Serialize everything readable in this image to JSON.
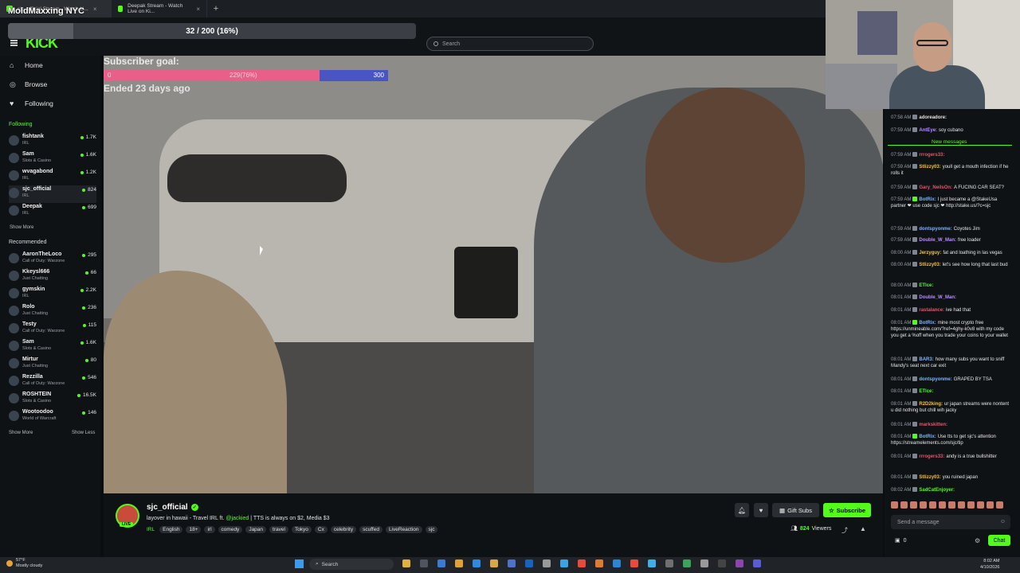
{
  "overlay": {
    "title": "MoldMaxxing NYC",
    "progress_text": "32 / 200 (16%)",
    "progress_fraction": 0.16
  },
  "browser": {
    "tabs": [
      {
        "label": "sjc_official Stream - Watch Li...",
        "active": true
      },
      {
        "label": "Deepak Stream - Watch Live on Ki...",
        "active": false
      }
    ],
    "new_tab": "+"
  },
  "header": {
    "logo": "KICK",
    "search_placeholder": "Search"
  },
  "sidebar": {
    "nav": [
      {
        "label": "Home",
        "icon": "home-icon",
        "glyph": "⌂"
      },
      {
        "label": "Browse",
        "icon": "compass-icon",
        "glyph": "◎"
      },
      {
        "label": "Following",
        "icon": "heart-icon",
        "glyph": "♥"
      }
    ],
    "following_label": "Following",
    "following": [
      {
        "name": "fishtank",
        "category": "IRL",
        "count": "1.7K"
      },
      {
        "name": "Sam",
        "category": "Slots & Casino",
        "count": "1.6K"
      },
      {
        "name": "wvagabond",
        "category": "IRL",
        "count": "1.2K"
      },
      {
        "name": "sjc_official",
        "category": "IRL",
        "count": "824"
      },
      {
        "name": "Deepak",
        "category": "IRL",
        "count": "699"
      }
    ],
    "show_more": "Show More",
    "recommended_label": "Recommended",
    "recommended": [
      {
        "name": "AaronTheLoco",
        "category": "Call of Duty: Warzone",
        "count": "295"
      },
      {
        "name": "Kkeysl666",
        "category": "Just Chatting",
        "count": "66"
      },
      {
        "name": "gymskin",
        "category": "IRL",
        "count": "2.2K"
      },
      {
        "name": "Rolo",
        "category": "Just Chatting",
        "count": "236"
      },
      {
        "name": "Testy",
        "category": "Call of Duty: Warzone",
        "count": "115"
      },
      {
        "name": "Sam",
        "category": "Slots & Casino",
        "count": "1.6K"
      },
      {
        "name": "Mirtur",
        "category": "Just Chatting",
        "count": "80"
      },
      {
        "name": "Rezzilla",
        "category": "Call of Duty: Warzone",
        "count": "546"
      },
      {
        "name": "ROSHTEIN",
        "category": "Slots & Casino",
        "count": "16.5K"
      },
      {
        "name": "Wootoodoo",
        "category": "World of Warcraft",
        "count": "146"
      }
    ],
    "show_more_2": "Show More",
    "show_less": "Show Less"
  },
  "goal": {
    "label": "Subscriber goal:",
    "start": "0",
    "current": "229(76%)",
    "end": "300",
    "fraction": 0.76,
    "ended": "Ended 23 days ago"
  },
  "stream": {
    "channel": "sjc_official",
    "live_badge": "LIVE",
    "title_pre": "layover in hawaii - Travel IRL ft. ",
    "title_mention": "@jackied",
    "title_post": " | TTS is always on $2, Media $3",
    "category": "IRL",
    "tags": [
      "English",
      "18+",
      "irl",
      "comedy",
      "Japan",
      "travel",
      "Tokyo",
      "Cx",
      "celebrity",
      "scuffed",
      "LiveReaction",
      "sjc"
    ],
    "gift_subs": "Gift Subs",
    "subscribe": "Subscribe",
    "viewers_count": "824",
    "viewers_label": "Viewers"
  },
  "chat": {
    "messages_top": [
      {
        "time": "07:58 AM",
        "user": "adoreadore:",
        "color": "#e0e0e0",
        "text": ""
      },
      {
        "time": "07:59 AM",
        "user": "AntEye:",
        "color": "#b98cff",
        "text": "soy cubano"
      }
    ],
    "new_messages": "New messages",
    "messages": [
      {
        "time": "07:59 AM",
        "user": "rrrogers33:",
        "color": "#e2566c",
        "text": ""
      },
      {
        "time": "07:59 AM",
        "user": "Stlizzy03:",
        "color": "#f3c23e",
        "text": "youll get a mouth infection if he rolls it"
      },
      {
        "time": "07:59 AM",
        "user": "Gary_NeilsOn:",
        "color": "#e2566c",
        "text": "A FUCING CAR SEAT?"
      },
      {
        "time": "07:59 AM",
        "user": "BotRix:",
        "color": "#7fb2ff",
        "text": "I just became a @StakeUsa partner ❤ use code sjc ❤ http://stake.us/?c=sjc"
      },
      {
        "time": "07:59 AM",
        "user": "dontspyonme:",
        "color": "#7fb2ff",
        "text": "Coyotes Jim"
      },
      {
        "time": "07:59 AM",
        "user": "Double_W_Man:",
        "color": "#b98cff",
        "text": "free loader"
      },
      {
        "time": "08:00 AM",
        "user": "Jerzyguy:",
        "color": "#f3c23e",
        "text": "fat and loathing in las vegas"
      },
      {
        "time": "08:00 AM",
        "user": "Stlizzy03:",
        "color": "#f3c23e",
        "text": "let's see how long that last bud"
      },
      {
        "time": "08:00 AM",
        "user": "ETlce:",
        "color": "#53fc18",
        "text": ""
      },
      {
        "time": "08:01 AM",
        "user": "Double_W_Man:",
        "color": "#b98cff",
        "text": ""
      },
      {
        "time": "08:01 AM",
        "user": "rastalance:",
        "color": "#e2566c",
        "text": "ive had that"
      },
      {
        "time": "08:01 AM",
        "user": "BotRix:",
        "color": "#7fb2ff",
        "text": "mine most crypto free https://unmineable.com/?ref=4ghy-k0v8 with my code you get a %off when you trade your coins to your wallet"
      },
      {
        "time": "08:01 AM",
        "user": "BAR3:",
        "color": "#7fb2ff",
        "text": "how many subs you want to sniff Mandy's seat next car exit"
      },
      {
        "time": "08:01 AM",
        "user": "dontspyonme:",
        "color": "#7fb2ff",
        "text": "GRAPED BY TSA"
      },
      {
        "time": "08:01 AM",
        "user": "ETlce:",
        "color": "#53fc18",
        "text": ""
      },
      {
        "time": "08:01 AM",
        "user": "R2D2king:",
        "color": "#f3c23e",
        "text": "ur japan streams were nontent u did nothing but chill wih jacky"
      },
      {
        "time": "08:01 AM",
        "user": "markskitten:",
        "color": "#e2566c",
        "text": ""
      },
      {
        "time": "08:01 AM",
        "user": "BotRix:",
        "color": "#7fb2ff",
        "text": "Use tts to get sjc's attention https://streamelements.com/sjc/tip"
      },
      {
        "time": "08:01 AM",
        "user": "rrrogers33:",
        "color": "#e2566c",
        "text": "andy is a true bullshitter"
      },
      {
        "time": "08:01 AM",
        "user": "Stlizzy03:",
        "color": "#f3c23e",
        "text": "you ruined japan"
      },
      {
        "time": "08:02 AM",
        "user": "SadCatEnjoyer:",
        "color": "#53fc18",
        "text": ""
      }
    ],
    "input_placeholder": "Send a message",
    "count": "0",
    "chat_button": "Chat"
  },
  "taskbar": {
    "weather_temp": "57°F",
    "weather_desc": "Mostly cloudy",
    "search": "Search",
    "time": "8:02 AM",
    "date": "4/10/2026"
  },
  "colors": {
    "accent": "#53fc18",
    "goal_fill": "#e8608a",
    "goal_track": "#4a55c4"
  }
}
